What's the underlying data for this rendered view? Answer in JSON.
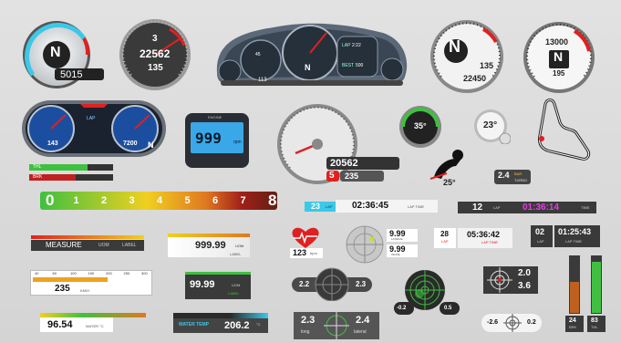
{
  "colors": {
    "accent_red": "#e02020",
    "accent_cyan": "#3cc8e8",
    "accent_green": "#40c040",
    "accent_yellow": "#f0d020",
    "accent_orange": "#e07820",
    "lcd_blue": "#3aa8e8",
    "dark_panel": "#333a44"
  },
  "gauge_tacho_cyan": {
    "gear": "N",
    "rpm": "5015"
  },
  "gauge_speedo_dark": {
    "gear": "3",
    "odometer": "22562",
    "speed": "135"
  },
  "dashboard_cluster": {
    "gear": "N",
    "lap_label": "LAP",
    "lap_value": "2:22",
    "best_label": "BEST",
    "best_value": "500",
    "bottom_value": "113",
    "speed_left": "45"
  },
  "gauge_white_gear": {
    "gear": "N",
    "speed": "135",
    "odometer": "22450"
  },
  "gauge_white_rpm": {
    "rpm": "13000",
    "gear": "N",
    "speed": "195"
  },
  "twin_blue_cluster": {
    "left_value": "143",
    "right_value": "7200",
    "lap_label": "LAP",
    "gear": "N"
  },
  "lcd_display": {
    "value": "999",
    "unit": "rpm",
    "brand": "ENGINE"
  },
  "speedo_red": {
    "odometer": "20562",
    "gear": "5",
    "speed": "235"
  },
  "round_green_gauge": {
    "value": "35°"
  },
  "small_silver_gauge": {
    "value": "23°"
  },
  "lean_angle": {
    "value": "25°"
  },
  "turbo_readout": {
    "value": "2.4",
    "unit": "BAR",
    "label": "TURBO"
  },
  "thl_brk_bars": {
    "thl_label": "THL",
    "brk_label": "BRK",
    "thl_fill": 0.7,
    "brk_fill": 0.55
  },
  "shift_bar": {
    "scale": [
      "0",
      "1",
      "2",
      "3",
      "4",
      "5",
      "6",
      "7",
      "8"
    ]
  },
  "lap_timer_cyan": {
    "lap": "23",
    "lap_label": "LAP",
    "time": "02:36:45",
    "time_label": "LAP TIME"
  },
  "lap_timer_dark": {
    "lap": "12",
    "lap_label": "LAP",
    "time": "01:36:14",
    "time_label": "TIME"
  },
  "measure_bar": {
    "label": "MEASURE",
    "unit": "UOM",
    "extra": "LABEL"
  },
  "yellow_readout": {
    "value": "999.99",
    "unit": "UOM",
    "label": "LABEL"
  },
  "heart_rate": {
    "value": "123",
    "unit": "bpm"
  },
  "gforce_circle": {
    "lateral_value": "9.99",
    "lateral_label": "LATERAL",
    "inline_value": "9.99",
    "inline_label": "INLINE"
  },
  "lap_28": {
    "lap": "28",
    "lap_label": "LAP",
    "time": "05:36:42",
    "time_label": "LAP TIME"
  },
  "lap_02": {
    "lap": "02",
    "lap_label": "LAP",
    "time": "01:25:43",
    "time_label": "LAP TIME"
  },
  "orange_scale": {
    "ticks": [
      "40",
      "60",
      "100",
      "150",
      "200",
      "250",
      "300"
    ],
    "value": "235",
    "unit": "KM/H"
  },
  "green_readout": {
    "value": "99.99",
    "unit": "UOM",
    "label": "LABEL"
  },
  "gforce_dark_pill": {
    "left": "2.2",
    "right": "2.3"
  },
  "radar_green": {
    "left": "-0.2",
    "right": "0.5"
  },
  "crosshair_box": {
    "top": "2.0",
    "bottom": "3.6"
  },
  "water_small": {
    "value": "96.54",
    "unit": "°C",
    "label": "WATER °C"
  },
  "water_temp_bar": {
    "label": "WATER TEMP",
    "value": "206.2",
    "unit": "°C"
  },
  "long_lat_panel": {
    "long_value": "2.3",
    "long_label": "long",
    "lat_value": "2.4",
    "lat_label": "lateral"
  },
  "target_small": {
    "left": "-2.6",
    "right": "0.2"
  },
  "vertical_bars": {
    "left_value": "24",
    "left_label": "BRK",
    "right_value": "83",
    "right_label": "THL",
    "left_fill": 0.55,
    "right_fill": 0.9
  }
}
